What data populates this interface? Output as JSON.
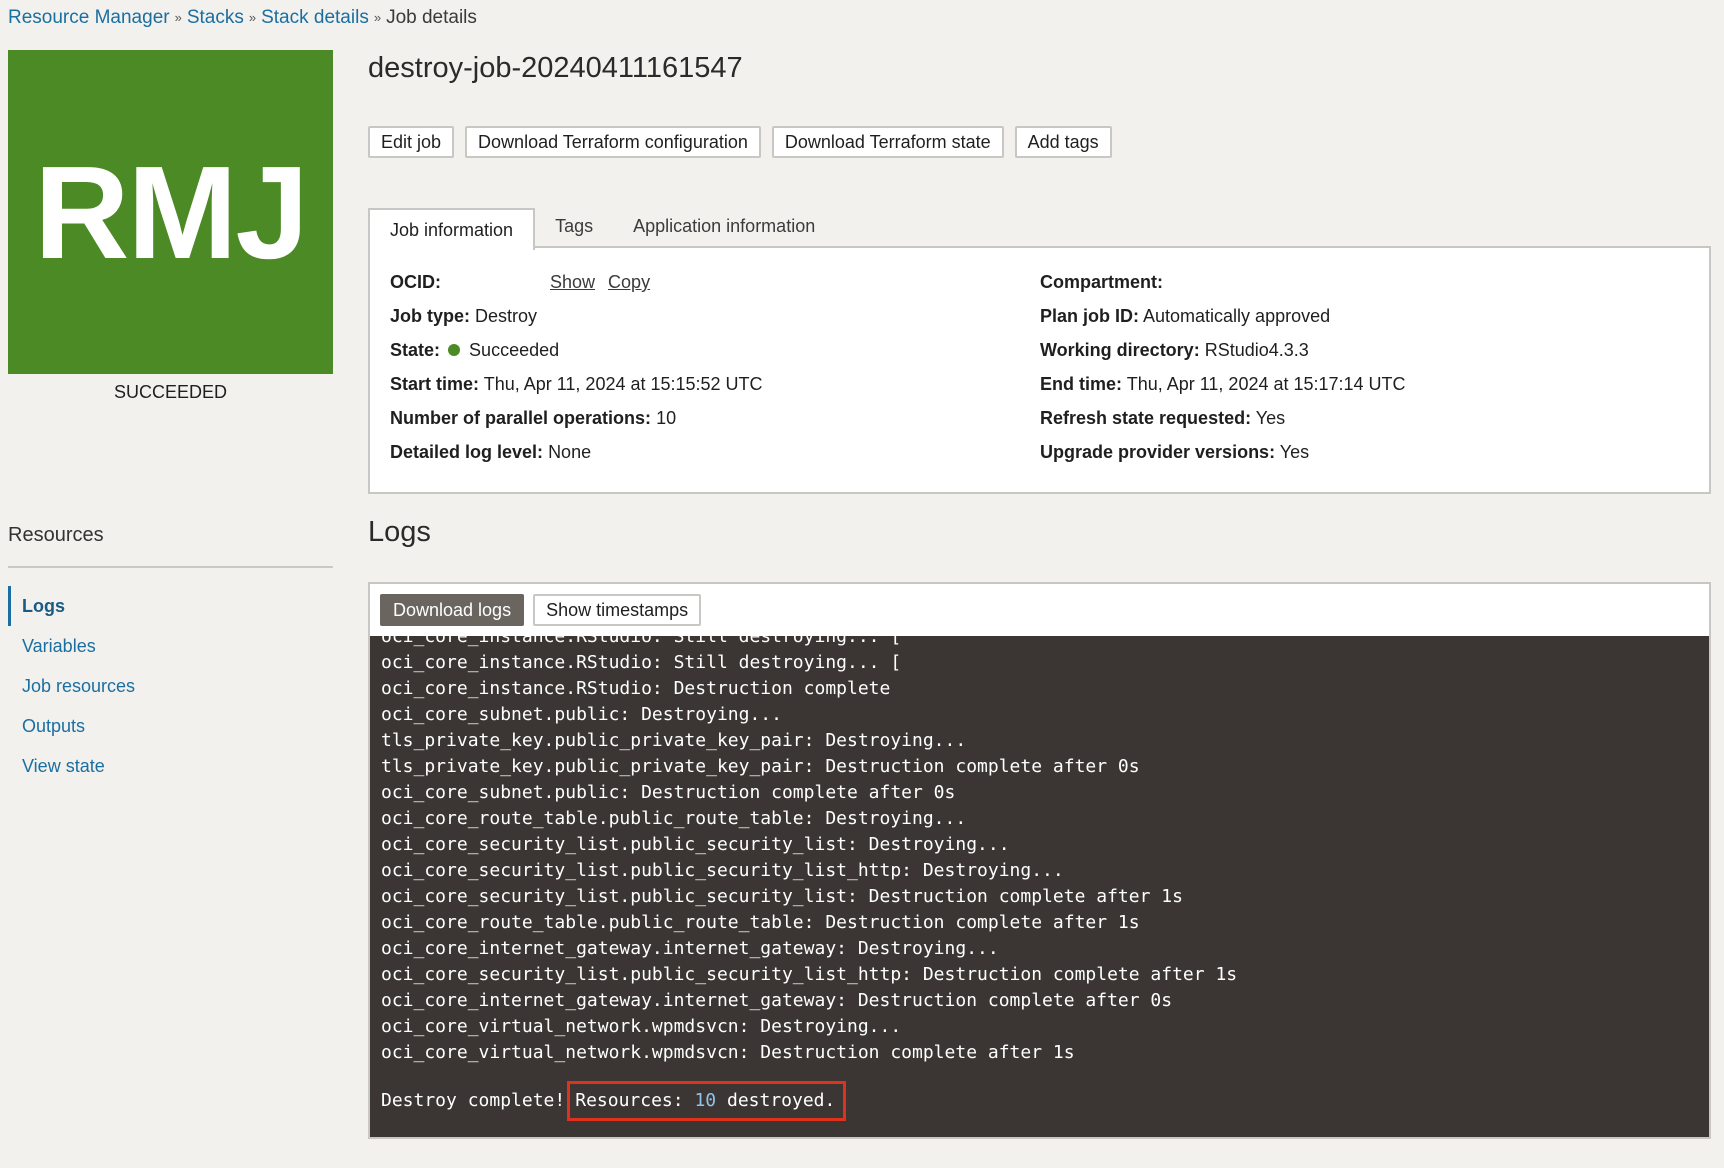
{
  "breadcrumb": {
    "items": [
      "Resource Manager",
      "Stacks",
      "Stack details"
    ],
    "separator": "»",
    "current": "Job details"
  },
  "badge": {
    "initials": "RMJ",
    "status": "SUCCEEDED",
    "color": "#4c8a26"
  },
  "resources": {
    "heading": "Resources",
    "items": [
      "Logs",
      "Variables",
      "Job resources",
      "Outputs",
      "View state"
    ]
  },
  "title": "destroy-job-20240411161547",
  "actions": {
    "edit": "Edit job",
    "download_config": "Download Terraform configuration",
    "download_state": "Download Terraform state",
    "add_tags": "Add tags"
  },
  "tabs": [
    "Job information",
    "Tags",
    "Application information"
  ],
  "job_info": {
    "ocid": {
      "label": "OCID:",
      "show": "Show",
      "copy": "Copy"
    },
    "job_type": {
      "label": "Job type:",
      "value": "Destroy"
    },
    "state": {
      "label": "State:",
      "value": "Succeeded"
    },
    "start_time": {
      "label": "Start time:",
      "value": "Thu, Apr 11, 2024 at 15:15:52 UTC"
    },
    "parallel_ops": {
      "label": "Number of parallel operations:",
      "value": "10"
    },
    "log_level": {
      "label": "Detailed log level:",
      "value": "None"
    },
    "compartment": {
      "label": "Compartment:",
      "value": ""
    },
    "plan_job_id": {
      "label": "Plan job ID:",
      "value": "Automatically approved"
    },
    "working_dir": {
      "label": "Working directory:",
      "value": "RStudio4.3.3"
    },
    "end_time": {
      "label": "End time:",
      "value": "Thu, Apr 11, 2024 at 15:17:14 UTC"
    },
    "refresh_state": {
      "label": "Refresh state requested:",
      "value": "Yes"
    },
    "upgrade_provider": {
      "label": "Upgrade provider versions:",
      "value": "Yes"
    }
  },
  "logs": {
    "heading": "Logs",
    "download_btn": "Download logs",
    "timestamps_btn": "Show timestamps",
    "lines": [
      "oci_core_instance.RStudio: Still destroying... [",
      "oci_core_instance.RStudio: Still destroying... [",
      "oci_core_instance.RStudio: Destruction complete",
      "oci_core_subnet.public: Destroying...",
      "tls_private_key.public_private_key_pair: Destroying...",
      "tls_private_key.public_private_key_pair: Destruction complete after 0s",
      "oci_core_subnet.public: Destruction complete after 0s",
      "oci_core_route_table.public_route_table: Destroying...",
      "oci_core_security_list.public_security_list: Destroying...",
      "oci_core_security_list.public_security_list_http: Destroying...",
      "oci_core_security_list.public_security_list: Destruction complete after 1s",
      "oci_core_route_table.public_route_table: Destruction complete after 1s",
      "oci_core_internet_gateway.internet_gateway: Destroying...",
      "oci_core_security_list.public_security_list_http: Destruction complete after 1s",
      "oci_core_internet_gateway.internet_gateway: Destruction complete after 0s",
      "oci_core_virtual_network.wpmdsvcn: Destroying...",
      "oci_core_virtual_network.wpmdsvcn: Destruction complete after 1s"
    ],
    "final_prefix": "Destroy complete!",
    "final_resources_label": "Resources:",
    "final_count": "10",
    "final_suffix": "destroyed."
  }
}
